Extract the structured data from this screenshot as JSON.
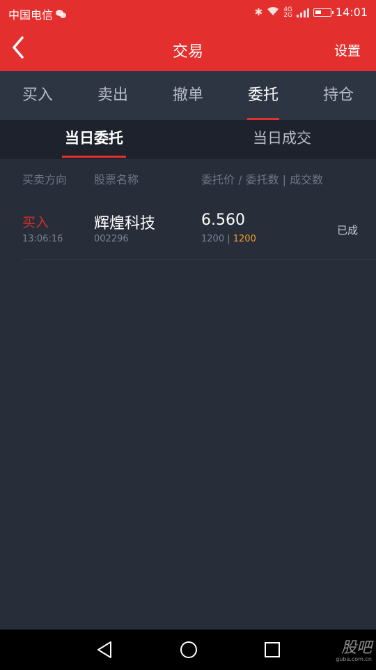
{
  "status_bar": {
    "carrier": "中国电信",
    "network": "4G",
    "network_sub": "2G",
    "time": "14:01"
  },
  "header": {
    "title": "交易",
    "settings_label": "设置"
  },
  "main_tabs": [
    {
      "label": "买入",
      "active": false
    },
    {
      "label": "卖出",
      "active": false
    },
    {
      "label": "撤单",
      "active": false
    },
    {
      "label": "委托",
      "active": true
    },
    {
      "label": "持仓",
      "active": false
    }
  ],
  "sub_tabs": [
    {
      "label": "当日委托",
      "active": true
    },
    {
      "label": "当日成交",
      "active": false
    }
  ],
  "columns": {
    "direction": "买卖方向",
    "name": "股票名称",
    "price_qty": "委托价 / 委托数 | 成交数"
  },
  "orders": [
    {
      "direction": "买入",
      "time": "13:06:16",
      "name": "辉煌科技",
      "code": "002296",
      "price": "6.560",
      "order_qty": "1200",
      "separator": " | ",
      "filled_qty": "1200",
      "status": "已成"
    }
  ],
  "watermark": {
    "logo": "股吧",
    "url": "guba.com.cn"
  },
  "colors": {
    "accent": "#e3302f",
    "background": "#272d39",
    "filled": "#f1a32a"
  }
}
